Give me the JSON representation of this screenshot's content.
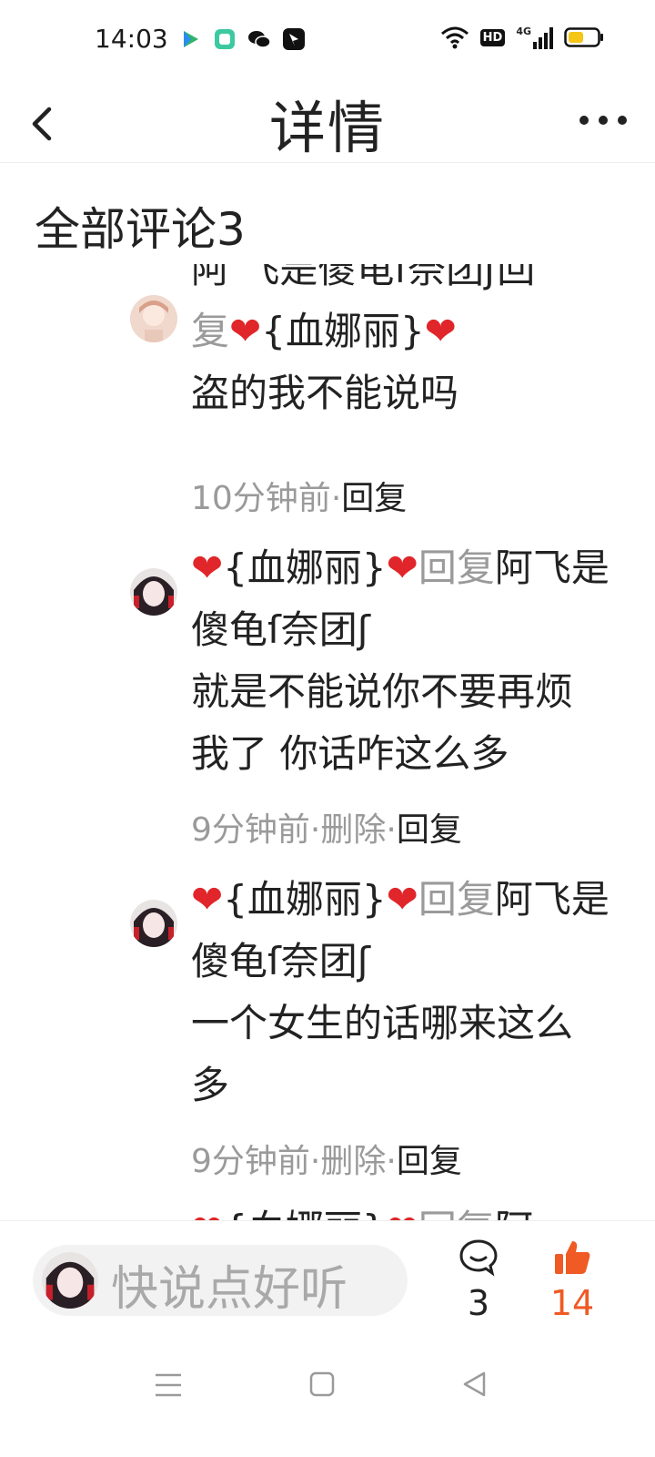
{
  "status_bar": {
    "time": "14:03",
    "left_icons": [
      "media-icon",
      "app-icon",
      "wechat-icon",
      "app2-icon"
    ],
    "right_icons": [
      "wifi-icon",
      "hd-icon",
      "4g-signal-icon",
      "battery-icon"
    ],
    "hd_label": "HD",
    "network_label": "4G"
  },
  "nav": {
    "title": "详情",
    "back_icon": "chevron-left-icon",
    "more_icon": "more-dots-icon"
  },
  "section": {
    "title": "全部评论3"
  },
  "comments": [
    {
      "heart1": "",
      "user": "",
      "heart2": "",
      "reply_word": "阿 飞是傻龟ſ奈团ʃ回",
      "target": "",
      "line2": "复❤️{血娜丽}❤️",
      "text": "盗的我不能说吗",
      "time": "10分钟前",
      "sep1": "·",
      "action1": "回复",
      "sep2": "",
      "action2": ""
    },
    {
      "heart1": "❤",
      "user": "{血娜丽}",
      "heart2": "❤",
      "reply_word": "回复",
      "target": "阿飞是傻龟ſ奈团ʃ",
      "text": "就是不能说你不要再烦我了 你话咋这么多",
      "time": "9分钟前",
      "sep1": "·",
      "action1": "删除",
      "sep2": "·",
      "action2": "回复"
    },
    {
      "heart1": "❤",
      "user": "{血娜丽}",
      "heart2": "❤",
      "reply_word": "回复",
      "target": "阿飞是傻龟ſ奈团ʃ",
      "text": "一个女生的话哪来这么多",
      "time": "9分钟前",
      "sep1": "·",
      "action1": "删除",
      "sep2": "·",
      "action2": "回复"
    },
    {
      "heart1": "❤",
      "user": "{血娜丽}",
      "heart2": "❤",
      "reply_word": "回复",
      "target": "阿"
    }
  ],
  "bottom_bar": {
    "placeholder": "快说点好听",
    "comment_count": "3",
    "like_count": "14",
    "like_color": "#f05a24"
  },
  "system_nav": {
    "icons": [
      "menu-icon",
      "home-icon",
      "back-triangle-icon"
    ]
  },
  "colors": {
    "heart": "#e0262a",
    "muted": "#9a9a9a",
    "accent": "#f05a24"
  }
}
